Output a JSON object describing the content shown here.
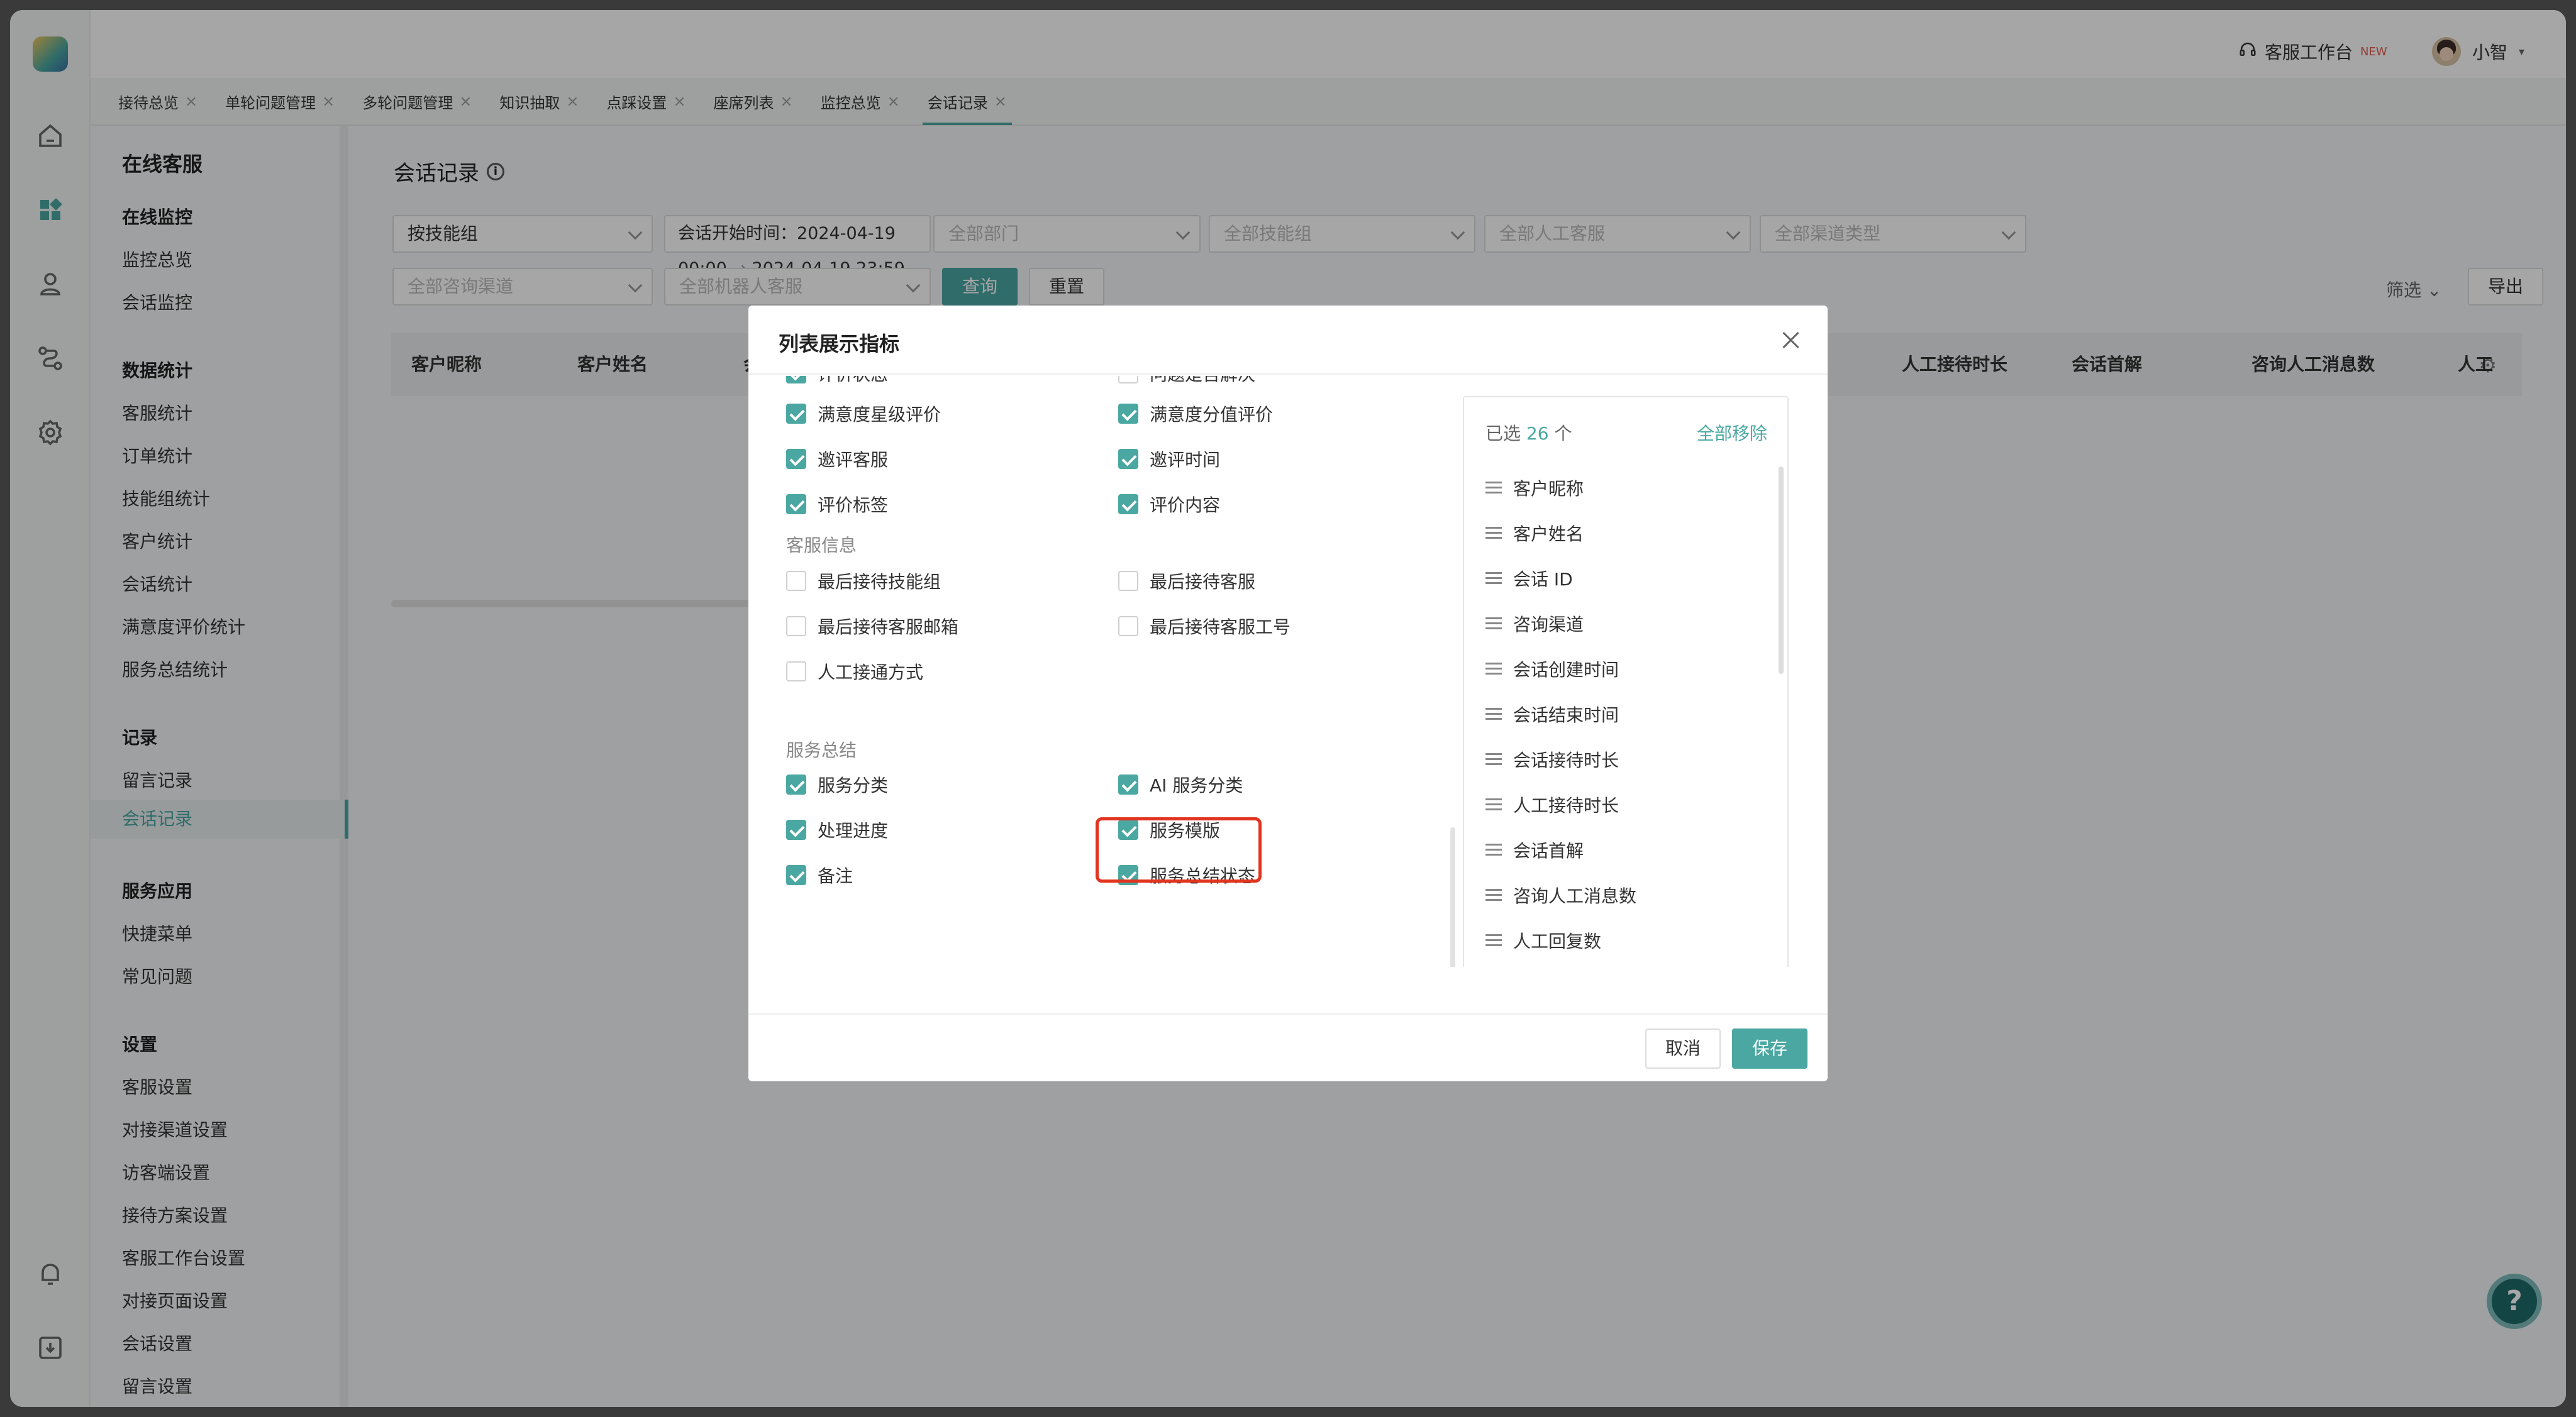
{
  "topbar": {
    "workspace_label": "客服工作台",
    "workspace_badge": "NEW",
    "user_name": "小智"
  },
  "tabs": [
    "接待总览",
    "单轮问题管理",
    "多轮问题管理",
    "知识抽取",
    "点踩设置",
    "座席列表",
    "监控总览",
    "会话记录"
  ],
  "active_tab": "会话记录",
  "sidebar": {
    "title": "在线客服",
    "groups": [
      {
        "label": "在线监控",
        "items": [
          "监控总览",
          "会话监控"
        ]
      },
      {
        "label": "数据统计",
        "items": [
          "客服统计",
          "订单统计",
          "技能组统计",
          "客户统计",
          "会话统计",
          "满意度评价统计",
          "服务总结统计"
        ]
      },
      {
        "label": "记录",
        "items": [
          "留言记录",
          "会话记录"
        ]
      },
      {
        "label": "服务应用",
        "items": [
          "快捷菜单",
          "常见问题"
        ]
      },
      {
        "label": "设置",
        "items": [
          "客服设置",
          "对接渠道设置",
          "访客端设置",
          "接待方案设置",
          "客服工作台设置",
          "对接页面设置",
          "会话设置",
          "留言设置"
        ]
      }
    ]
  },
  "page": {
    "title": "会话记录",
    "filters": {
      "skill_group_mode": "按技能组",
      "time_label": "会话开始时间：",
      "time_start": "2024-04-19 00:00",
      "time_arrow": "→",
      "time_end": "2024-04-19 23:59",
      "dept": "全部部门",
      "skill_group": "全部技能组",
      "agent": "全部人工客服",
      "channel_type": "全部渠道类型",
      "consult_channel": "全部咨询渠道",
      "robot_agent": "全部机器人客服",
      "query_label": "查询",
      "reset_label": "重置",
      "filter_label": "筛选",
      "export_label": "导出"
    },
    "table_headers": [
      "客户昵称",
      "客户姓名",
      "会",
      "人工接待时长",
      "会话首解",
      "咨询人工消息数",
      "人工"
    ]
  },
  "modal": {
    "title": "列表展示指标",
    "partial_row": [
      "评价状态",
      "问题是否解决"
    ],
    "rows_top": [
      [
        "满意度星级评价",
        "满意度分值评价"
      ],
      [
        "邀评客服",
        "邀评时间"
      ],
      [
        "评价标签",
        "评价内容"
      ]
    ],
    "section_agent": "客服信息",
    "rows_agent": [
      [
        "最后接待技能组",
        "最后接待客服"
      ],
      [
        "最后接待客服邮箱",
        "最后接待客服工号"
      ],
      [
        "人工接通方式",
        ""
      ]
    ],
    "section_summary": "服务总结",
    "rows_summary": [
      [
        "服务分类",
        "AI 服务分类"
      ],
      [
        "处理进度",
        "服务模版"
      ],
      [
        "备注",
        "服务总结状态"
      ]
    ],
    "selected_prefix": "已选",
    "selected_count": "26",
    "selected_suffix": "个",
    "remove_all": "全部移除",
    "selected_items": [
      "客户昵称",
      "客户姓名",
      "会话 ID",
      "咨询渠道",
      "会话创建时间",
      "会话结束时间",
      "会话接待时长",
      "人工接待时长",
      "会话首解",
      "咨询人工消息数",
      "人工回复数"
    ],
    "cancel_label": "取消",
    "save_label": "保存"
  },
  "help_icon": "?",
  "accent_color": "#4aa7a1"
}
